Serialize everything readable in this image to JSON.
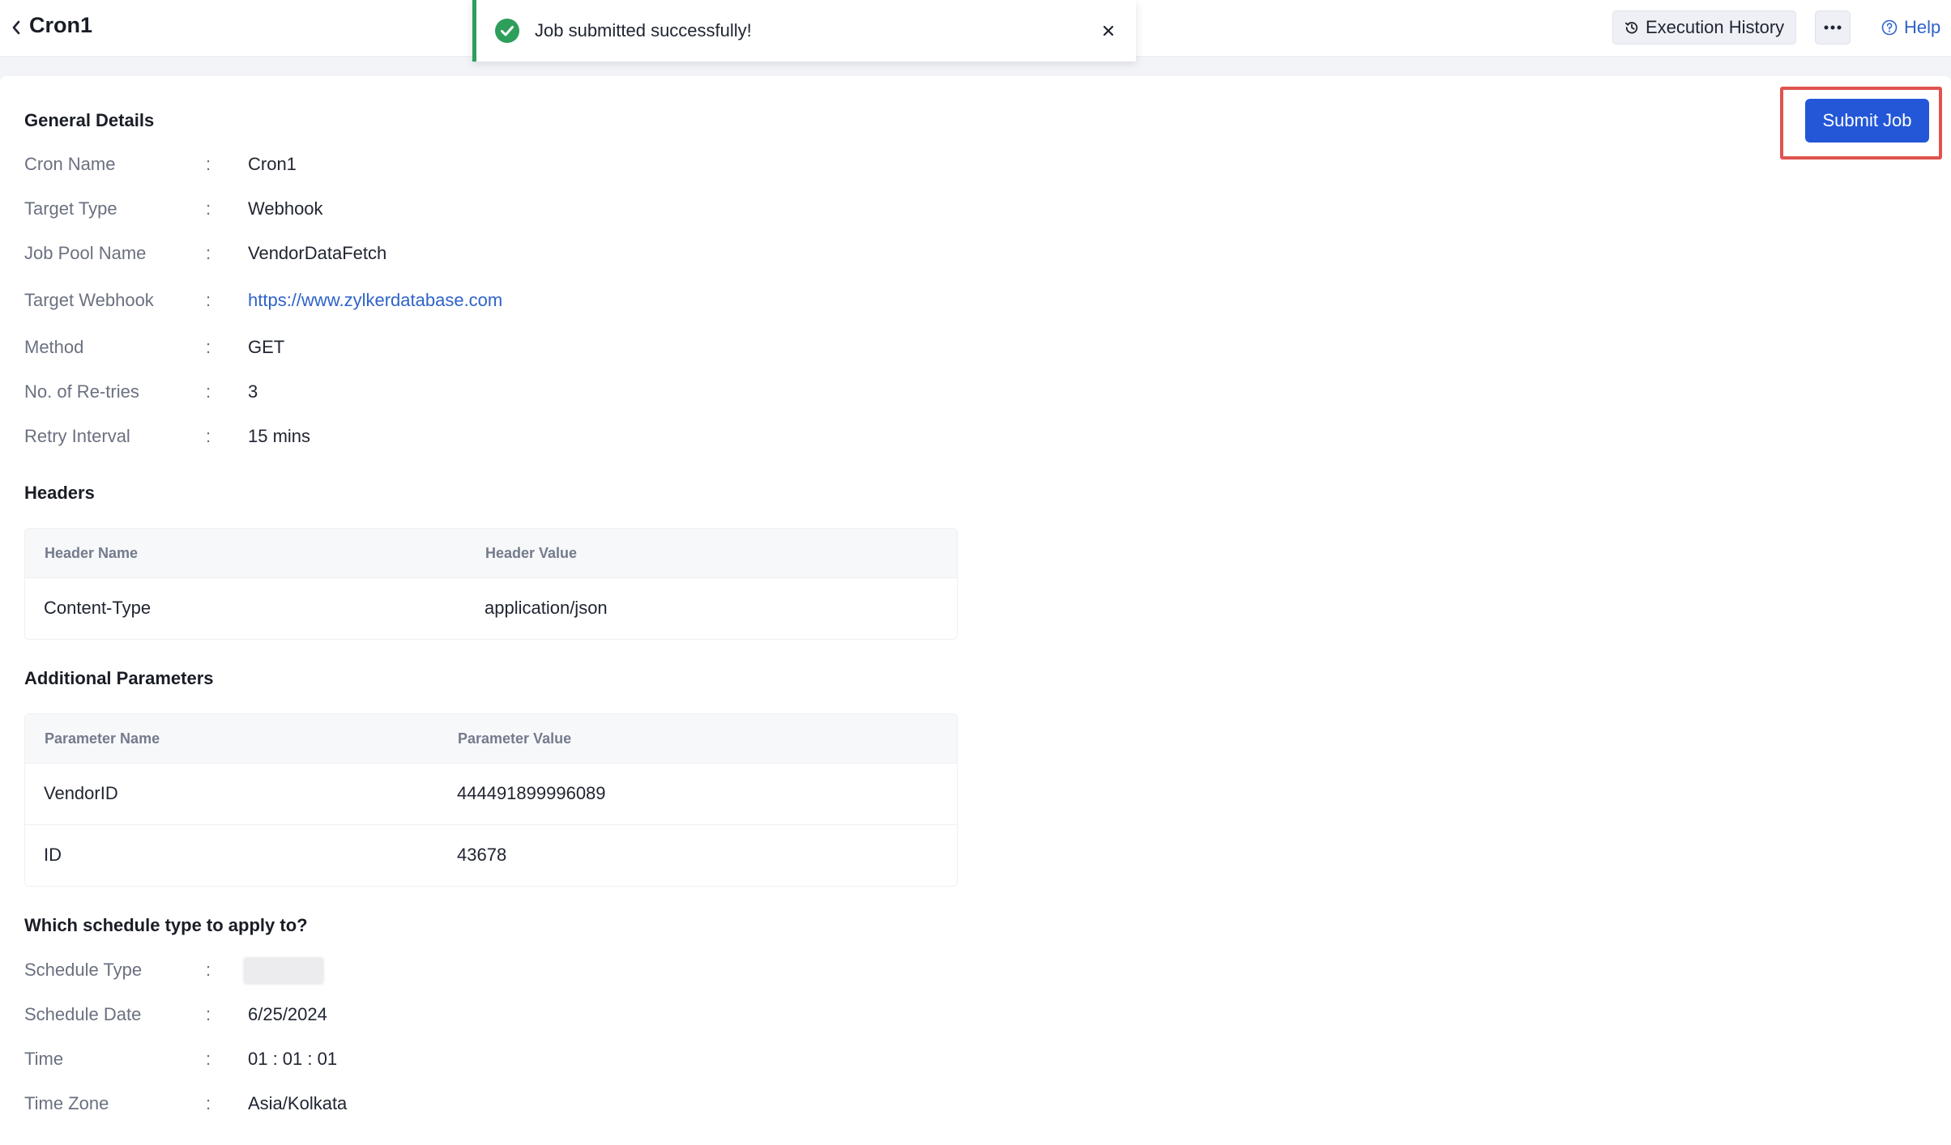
{
  "header": {
    "title": "Cron1",
    "execution_history_label": "Execution History",
    "help_label": "Help"
  },
  "toast": {
    "message": "Job submitted successfully!"
  },
  "actions": {
    "submit_label": "Submit Job"
  },
  "general": {
    "title": "General Details",
    "fields": [
      {
        "label": "Cron Name",
        "value": "Cron1"
      },
      {
        "label": "Target Type",
        "value": "Webhook"
      },
      {
        "label": "Job Pool Name",
        "value": "VendorDataFetch"
      },
      {
        "label": "Target Webhook",
        "value": "https://www.zylkerdatabase.com"
      },
      {
        "label": "Method",
        "value": "GET"
      },
      {
        "label": "No. of Re-tries",
        "value": "3"
      },
      {
        "label": "Retry Interval",
        "value": "15 mins"
      }
    ]
  },
  "headers": {
    "title": "Headers",
    "columns": [
      "Header Name",
      "Header Value"
    ],
    "rows": [
      [
        "Content-Type",
        "application/json"
      ]
    ]
  },
  "params": {
    "title": "Additional Parameters",
    "columns": [
      "Parameter Name",
      "Parameter Value"
    ],
    "rows": [
      [
        "VendorID",
        "444491899996089"
      ],
      [
        "ID",
        "43678"
      ]
    ]
  },
  "schedule": {
    "title": "Which schedule type to apply to?",
    "fields": [
      {
        "label": "Schedule Type",
        "value": ""
      },
      {
        "label": "Schedule Date",
        "value": "6/25/2024"
      },
      {
        "label": "Time",
        "value": "01 : 01 : 01"
      },
      {
        "label": "Time Zone",
        "value": "Asia/Kolkata"
      }
    ]
  },
  "colors": {
    "accent": "#2357d8",
    "success": "#2e9e5b",
    "highlight_frame": "#e0534f",
    "link": "#2f63c9"
  },
  "icons": {
    "back": "chevron-left-icon",
    "history": "history-icon",
    "more": "more-horizontal-icon",
    "help": "help-circle-icon",
    "success": "check-circle-icon",
    "close": "close-icon"
  }
}
